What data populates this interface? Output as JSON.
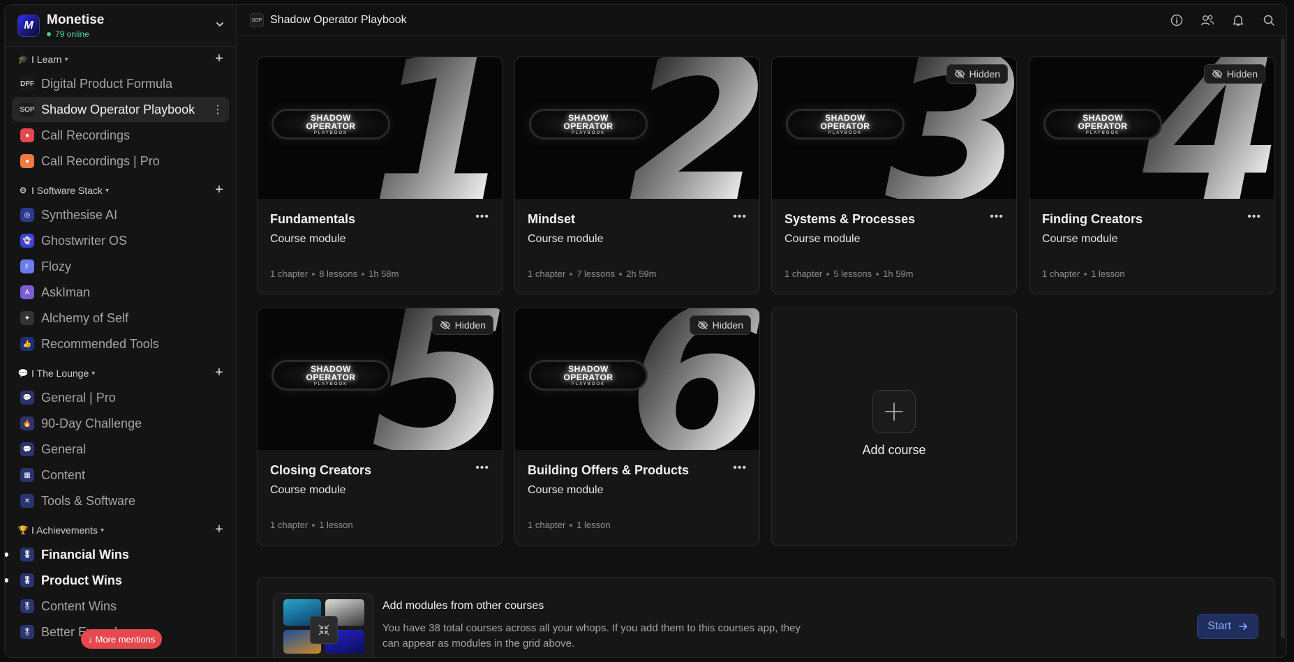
{
  "workspace": {
    "name": "Monetise",
    "online": "79 online"
  },
  "sidebar": {
    "sections": [
      {
        "title": "I Learn",
        "emoji": "🎓",
        "items": [
          {
            "label": "Digital Product Formula",
            "icon_color": "#1b1b1b",
            "icon_text": "DPF"
          },
          {
            "label": "Shadow Operator Playbook",
            "icon_color": "#1b1b1b",
            "icon_text": "SOP",
            "active": true
          },
          {
            "label": "Call Recordings",
            "icon_color": "#e5484d",
            "icon_text": "●"
          },
          {
            "label": "Call Recordings | Pro",
            "icon_color": "#f07b3f",
            "icon_text": "●"
          }
        ]
      },
      {
        "title": "I Software Stack",
        "emoji": "⚙",
        "items": [
          {
            "label": "Synthesise AI",
            "icon_color": "#2b3a8a",
            "icon_text": "◎"
          },
          {
            "label": "Ghostwriter OS",
            "icon_color": "#3b44d6",
            "icon_text": "👻"
          },
          {
            "label": "Flozy",
            "icon_color": "#6c7cf0",
            "icon_text": "F"
          },
          {
            "label": "AskIman",
            "icon_color": "#7b5bd6",
            "icon_text": "A"
          },
          {
            "label": "Alchemy of Self",
            "icon_color": "#333333",
            "icon_text": "✦"
          },
          {
            "label": "Recommended Tools",
            "icon_color": "#1e2f7a",
            "icon_text": "👍"
          }
        ]
      },
      {
        "title": "I The Lounge",
        "emoji": "💬",
        "items": [
          {
            "label": "General | Pro",
            "icon_color": "#2a3570",
            "icon_text": "💬"
          },
          {
            "label": "90-Day Challenge",
            "icon_color": "#2a3570",
            "icon_text": "🔥"
          },
          {
            "label": "General",
            "icon_color": "#2a3570",
            "icon_text": "💬"
          },
          {
            "label": "Content",
            "icon_color": "#2a3570",
            "icon_text": "▦"
          },
          {
            "label": "Tools & Software",
            "icon_color": "#2a3570",
            "icon_text": "✕"
          }
        ]
      },
      {
        "title": "I Achievements",
        "emoji": "🏆",
        "items": [
          {
            "label": "Financial Wins",
            "icon_color": "#2a3570",
            "icon_text": "🎖",
            "bold": true,
            "unread": true
          },
          {
            "label": "Product Wins",
            "icon_color": "#2a3570",
            "icon_text": "🎖",
            "bold": true,
            "unread": true
          },
          {
            "label": "Content Wins",
            "icon_color": "#2a3570",
            "icon_text": "🎖"
          },
          {
            "label": "Better Everyday",
            "icon_color": "#2a3570",
            "icon_text": "🎖"
          }
        ]
      }
    ],
    "mentions_label": "More mentions"
  },
  "topbar": {
    "title": "Shadow Operator Playbook",
    "icons": [
      "info-icon",
      "members-icon",
      "bell-icon",
      "search-icon"
    ]
  },
  "logo_text": {
    "line1": "SHADOW",
    "line2": "OPERATOR",
    "line3": "PLAYBOOK"
  },
  "hidden_label": "Hidden",
  "courses": [
    {
      "number": "1",
      "title": "Fundamentals",
      "subtitle": "Course module",
      "meta": [
        "1 chapter",
        "8 lessons",
        "1h 58m"
      ],
      "hidden": false
    },
    {
      "number": "2",
      "title": "Mindset",
      "subtitle": "Course module",
      "meta": [
        "1 chapter",
        "7 lessons",
        "2h 59m"
      ],
      "hidden": false
    },
    {
      "number": "3",
      "title": "Systems & Processes",
      "subtitle": "Course module",
      "meta": [
        "1 chapter",
        "5 lessons",
        "1h 59m"
      ],
      "hidden": true
    },
    {
      "number": "4",
      "title": "Finding Creators",
      "subtitle": "Course module",
      "meta": [
        "1 chapter",
        "1 lesson"
      ],
      "hidden": true
    },
    {
      "number": "5",
      "title": "Closing Creators",
      "subtitle": "Course module",
      "meta": [
        "1 chapter",
        "1 lesson"
      ],
      "hidden": true
    },
    {
      "number": "6",
      "title": "Building Offers & Products",
      "subtitle": "Course module",
      "meta": [
        "1 chapter",
        "1 lesson"
      ],
      "hidden": true
    }
  ],
  "add_course_label": "Add course",
  "banner": {
    "title": "Add modules from other courses",
    "description": "You have 38 total courses across all your whops. If you add them to this courses app, they can appear as modules in the grid above.",
    "start_label": "Start"
  },
  "colors": {
    "accent": "#8eaaff",
    "online": "#3bd183",
    "mentions": "#e5484d"
  }
}
